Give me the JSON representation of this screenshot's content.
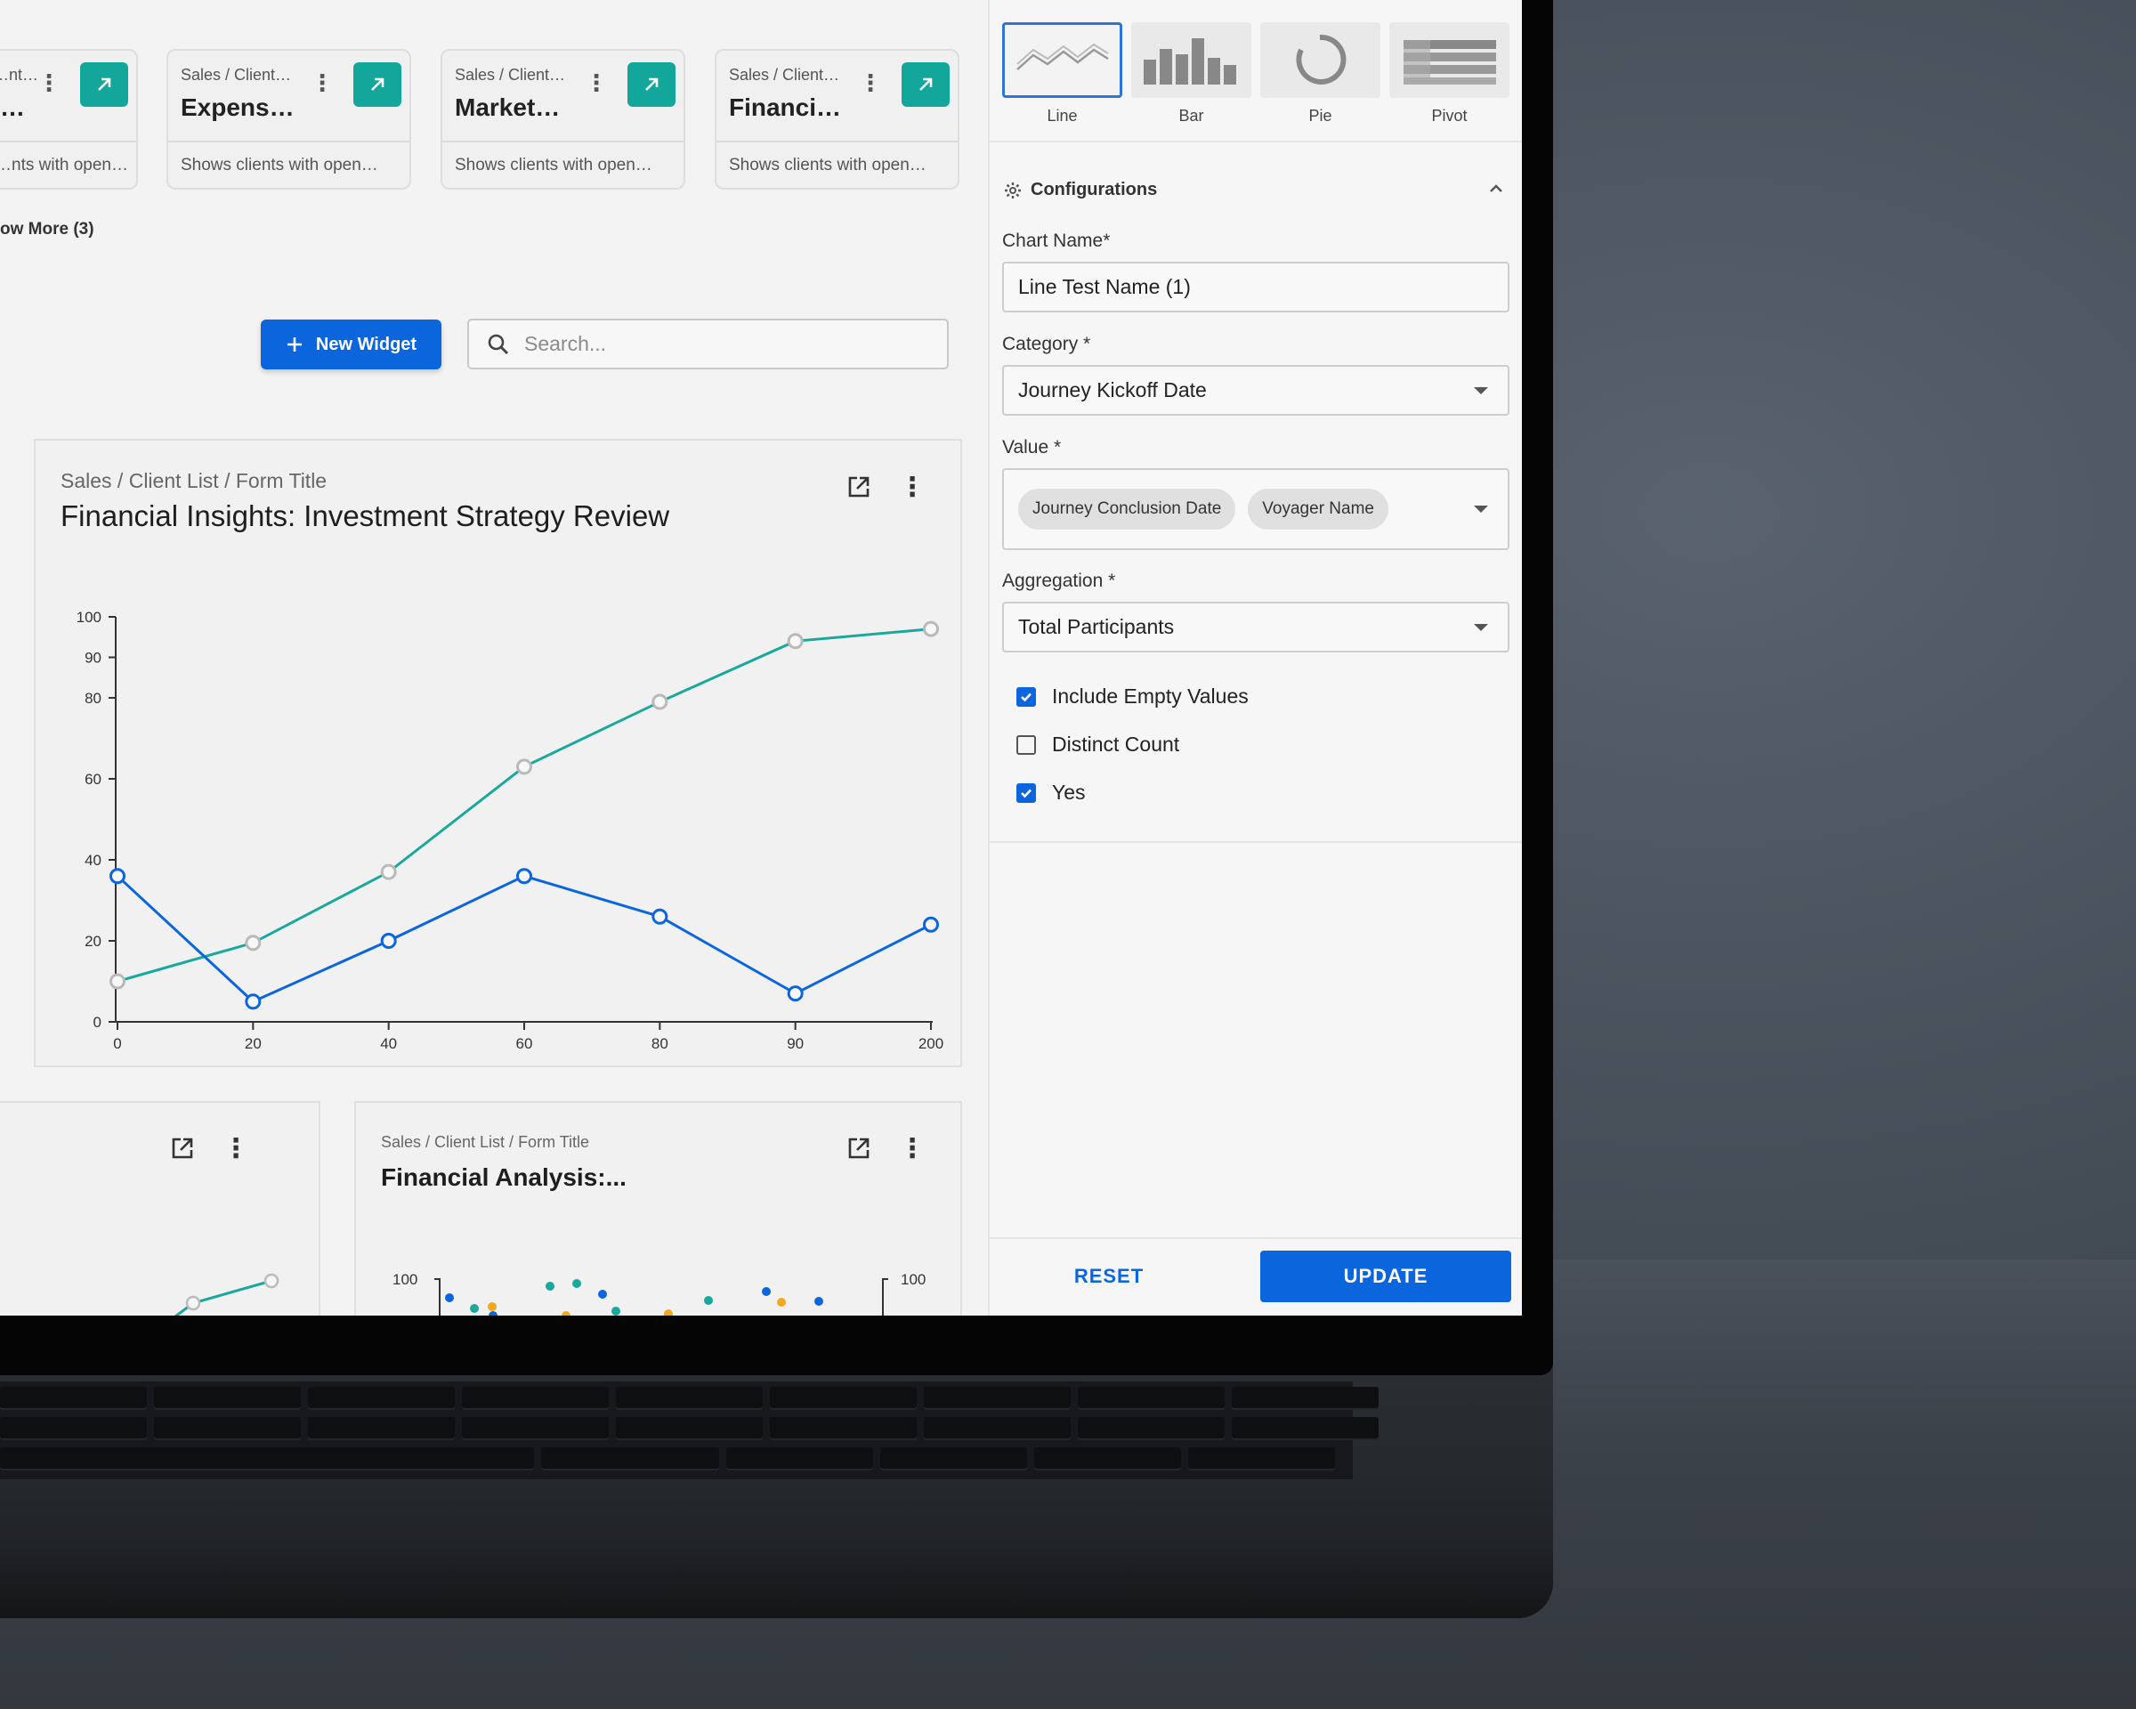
{
  "report_cards": [
    {
      "crumb": "…nt…",
      "title": "…",
      "description": "…nts with open…"
    },
    {
      "crumb": "Sales / Client…",
      "title": "Expens…",
      "description": "Shows clients with open…"
    },
    {
      "crumb": "Sales / Client…",
      "title": "Market…",
      "description": "Shows clients with open…"
    },
    {
      "crumb": "Sales / Client…",
      "title": "Financi…",
      "description": "Shows clients with open…"
    }
  ],
  "show_more_label": "ow More (3)",
  "toolbar": {
    "new_widget_label": "New Widget",
    "search_placeholder": "Search..."
  },
  "main_widget": {
    "crumb": "Sales  /  Client List  /  Form Title",
    "title": "Financial Insights: Investment Strategy Review"
  },
  "chart_data": {
    "type": "line",
    "x": [
      "0",
      "20",
      "40",
      "60",
      "80",
      "90",
      "200"
    ],
    "yticks": [
      0,
      20,
      40,
      60,
      80,
      90,
      100
    ],
    "ylim": [
      0,
      100
    ],
    "grid": false,
    "series": [
      {
        "color": "#1aa89c",
        "values": [
          10,
          19.5,
          37,
          63,
          79,
          94,
          97
        ]
      },
      {
        "color": "#0b66de",
        "values": [
          36,
          5,
          20,
          36,
          26,
          7,
          24
        ]
      }
    ]
  },
  "bottom_widget": {
    "crumb": "Sales   /   Client List   /   Form Title",
    "title": "Financial Analysis:...",
    "axis_left_label": "100",
    "axis_right_label": "100"
  },
  "panel": {
    "chart_types": [
      "Line",
      "Bar",
      "Pie",
      "Pivot"
    ],
    "configurations_label": "Configurations",
    "chart_name_label": "Chart Name*",
    "chart_name_value": "Line Test Name (1)",
    "category_label": "Category *",
    "category_value": "Journey Kickoff Date",
    "value_label": "Value *",
    "value_chips": [
      "Journey Conclusion Date",
      "Voyager Name"
    ],
    "aggregation_label": "Aggregation *",
    "aggregation_value": "Total Participants",
    "checkboxes": [
      {
        "label": "Include Empty Values",
        "checked": true
      },
      {
        "label": "Distinct Count",
        "checked": false
      },
      {
        "label": "Yes",
        "checked": true
      }
    ],
    "reset_label": "RESET",
    "update_label": "UPDATE"
  },
  "colors": {
    "accent": "#0b66de",
    "teal": "#13a79b"
  }
}
